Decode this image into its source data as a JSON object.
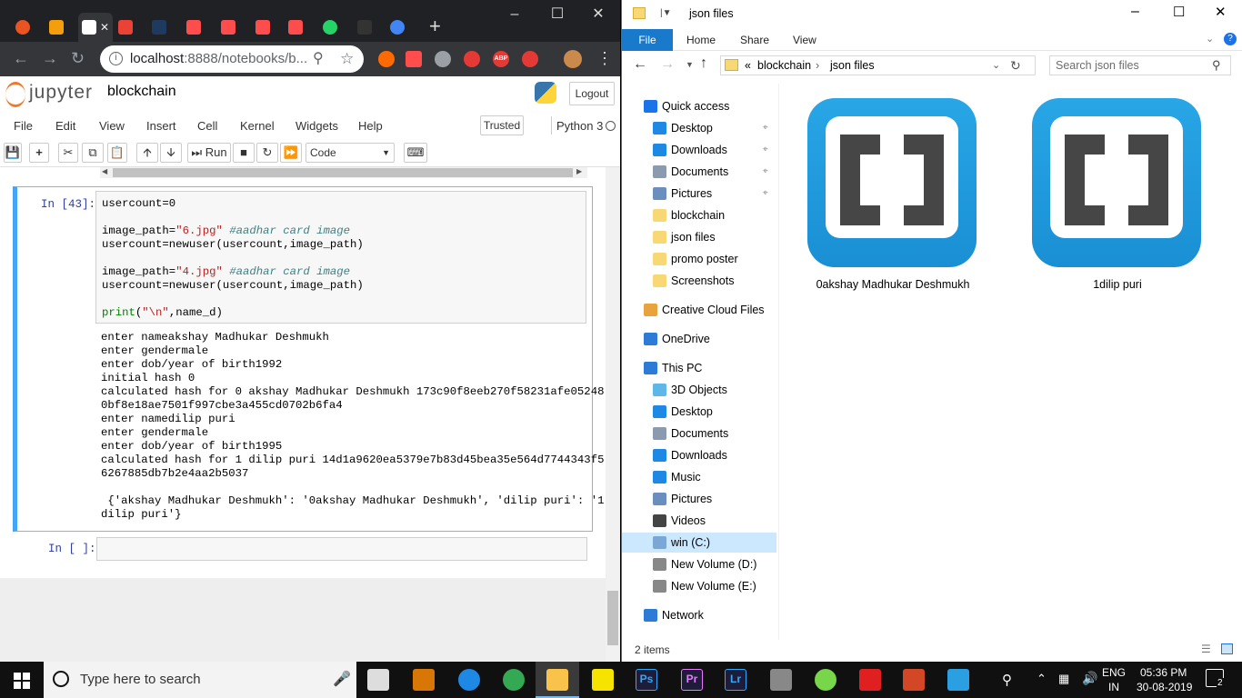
{
  "browser": {
    "tabs": [
      {
        "icon": "ubuntu-icon",
        "color": "#e95420"
      },
      {
        "icon": "book-icon",
        "color": "#f59e0b"
      },
      {
        "icon": "jupyter-tab-icon",
        "color": "#ffffff",
        "active": true
      },
      {
        "icon": "gmail-icon",
        "color": "#ea4335"
      },
      {
        "icon": "hackerrank-icon",
        "color": "#1f3a5f"
      },
      {
        "icon": "arrow-icon",
        "color": "#ff4d4d"
      },
      {
        "icon": "arrow-icon",
        "color": "#ff4d4d"
      },
      {
        "icon": "arrow-icon",
        "color": "#ff4d4d"
      },
      {
        "icon": "arrow-icon",
        "color": "#ff4d4d"
      },
      {
        "icon": "whatsapp-icon",
        "color": "#25d366"
      },
      {
        "icon": "github-icon",
        "color": "#333333"
      },
      {
        "icon": "google-icon",
        "color": "#4285f4"
      }
    ],
    "url_host": "localhost",
    "url_rest": ":8888/notebooks/b..."
  },
  "jupyter": {
    "logo_text": "jupyter",
    "notebook_name": "blockchain",
    "logout_label": "Logout",
    "menu": [
      "File",
      "Edit",
      "View",
      "Insert",
      "Cell",
      "Kernel",
      "Widgets",
      "Help"
    ],
    "trusted_label": "Trusted",
    "kernel_label": "Python 3",
    "run_label": "Run",
    "cell_type": "Code",
    "cell1_prompt": "In [43]:",
    "cell2_prompt": "In [ ]:",
    "code_lines": [
      [
        {
          "t": "usercount=0"
        }
      ],
      [],
      [
        {
          "t": "image_path="
        },
        {
          "t": "\"6.jpg\"",
          "c": "str"
        },
        {
          "t": " "
        },
        {
          "t": "#aadhar card image",
          "c": "cm"
        }
      ],
      [
        {
          "t": "usercount=newuser(usercount,image_path)"
        }
      ],
      [],
      [
        {
          "t": "image_path="
        },
        {
          "t": "\"4.jpg\"",
          "c": "str"
        },
        {
          "t": " "
        },
        {
          "t": "#aadhar card image",
          "c": "cm"
        }
      ],
      [
        {
          "t": "usercount=newuser(usercount,image_path)"
        }
      ],
      [],
      [
        {
          "t": "print",
          "c": "kw"
        },
        {
          "t": "("
        },
        {
          "t": "\"\\n\"",
          "c": "str"
        },
        {
          "t": ",name_d)"
        }
      ]
    ],
    "output_lines": [
      "enter nameakshay Madhukar Deshmukh",
      "enter gendermale",
      "enter dob/year of birth1992",
      "initial hash 0",
      "calculated hash for 0 akshay Madhukar Deshmukh 173c90f8eeb270f58231afe05248",
      "0bf8e18ae7501f997cbe3a455cd0702b6fa4",
      "enter namedilip puri",
      "enter gendermale",
      "enter dob/year of birth1995",
      "calculated hash for 1 dilip puri 14d1a9620ea5379e7b83d45bea35e564d7744343f5",
      "6267885db7b2e4aa2b5037",
      "",
      " {'akshay Madhukar Deshmukh': '0akshay Madhukar Deshmukh', 'dilip puri': '1",
      "dilip puri'}"
    ]
  },
  "explorer": {
    "title": "json files",
    "ribbon": [
      "File",
      "Home",
      "Share",
      "View"
    ],
    "path": [
      "blockchain",
      "json files"
    ],
    "path_prefix": "«",
    "search_placeholder": "Search json files",
    "nav": [
      {
        "label": "Quick access",
        "icon": "star-icon",
        "indent": 0,
        "color": "#1a73e8"
      },
      {
        "label": "Desktop",
        "icon": "desktop-icon",
        "indent": 1,
        "pin": true,
        "color": "#1e88e5"
      },
      {
        "label": "Downloads",
        "icon": "download-icon",
        "indent": 1,
        "pin": true,
        "color": "#1e88e5"
      },
      {
        "label": "Documents",
        "icon": "documents-icon",
        "indent": 1,
        "pin": true,
        "color": "#8a9bb0"
      },
      {
        "label": "Pictures",
        "icon": "pictures-icon",
        "indent": 1,
        "pin": true,
        "color": "#6a8fbf"
      },
      {
        "label": "blockchain",
        "icon": "folder-icon",
        "indent": 1,
        "color": "#f8d775"
      },
      {
        "label": "json files",
        "icon": "folder-icon",
        "indent": 1,
        "color": "#f8d775"
      },
      {
        "label": "promo poster",
        "icon": "folder-icon",
        "indent": 1,
        "color": "#f8d775"
      },
      {
        "label": "Screenshots",
        "icon": "folder-icon",
        "indent": 1,
        "color": "#f8d775"
      },
      {
        "label": "Creative Cloud Files",
        "icon": "creative-cloud-icon",
        "indent": 0,
        "color": "#e8a33d"
      },
      {
        "label": "OneDrive",
        "icon": "onedrive-icon",
        "indent": 0,
        "color": "#2c7bd6"
      },
      {
        "label": "This PC",
        "icon": "computer-icon",
        "indent": 0,
        "color": "#2c7bd6"
      },
      {
        "label": "3D Objects",
        "icon": "cube-icon",
        "indent": 1,
        "color": "#5fb6e8"
      },
      {
        "label": "Desktop",
        "icon": "desktop-icon",
        "indent": 1,
        "color": "#1e88e5"
      },
      {
        "label": "Documents",
        "icon": "documents-icon",
        "indent": 1,
        "color": "#8a9bb0"
      },
      {
        "label": "Downloads",
        "icon": "download-icon",
        "indent": 1,
        "color": "#1e88e5"
      },
      {
        "label": "Music",
        "icon": "music-icon",
        "indent": 1,
        "color": "#1e88e5"
      },
      {
        "label": "Pictures",
        "icon": "pictures-icon",
        "indent": 1,
        "color": "#6a8fbf"
      },
      {
        "label": "Videos",
        "icon": "videos-icon",
        "indent": 1,
        "color": "#444444"
      },
      {
        "label": "win  (C:)",
        "icon": "drive-icon",
        "indent": 1,
        "selected": true,
        "color": "#7aa7d6"
      },
      {
        "label": "New Volume (D:)",
        "icon": "drive-icon",
        "indent": 1,
        "color": "#888888"
      },
      {
        "label": "New Volume (E:)",
        "icon": "drive-icon",
        "indent": 1,
        "color": "#888888"
      },
      {
        "label": "Network",
        "icon": "network-icon",
        "indent": 0,
        "color": "#2c7bd6"
      }
    ],
    "files": [
      "0akshay Madhukar Deshmukh",
      "1dilip puri"
    ],
    "status": "2 items"
  },
  "taskbar": {
    "search_placeholder": "Type here to search",
    "apps": [
      {
        "icon": "task-view-icon",
        "color": "#dddddd"
      },
      {
        "icon": "paint-icon",
        "color": "#d97706"
      },
      {
        "icon": "edge-icon",
        "color": "#1e88e5"
      },
      {
        "icon": "chrome-icon",
        "color": "#34a853"
      },
      {
        "icon": "file-explorer-icon",
        "color": "#f8c24b",
        "active": true
      },
      {
        "icon": "sticky-notes-icon",
        "color": "#f6e300"
      },
      {
        "icon": "photoshop-icon",
        "color": "#31a8ff",
        "text": "Ps"
      },
      {
        "icon": "premiere-icon",
        "color": "#ea77ff",
        "text": "Pr"
      },
      {
        "icon": "lightroom-icon",
        "color": "#31a8ff",
        "text": "Lr"
      },
      {
        "icon": "terminal-icon",
        "color": "#888888"
      },
      {
        "icon": "utorrent-icon",
        "color": "#78d64b"
      },
      {
        "icon": "acrobat-icon",
        "color": "#e02020"
      },
      {
        "icon": "powerpoint-icon",
        "color": "#d24726"
      },
      {
        "icon": "brackets-icon",
        "color": "#2a9fe2"
      }
    ],
    "lang1": "ENG",
    "lang2": "IN",
    "time": "05:36 PM",
    "date": "30-08-2019",
    "notif_count": "2"
  }
}
